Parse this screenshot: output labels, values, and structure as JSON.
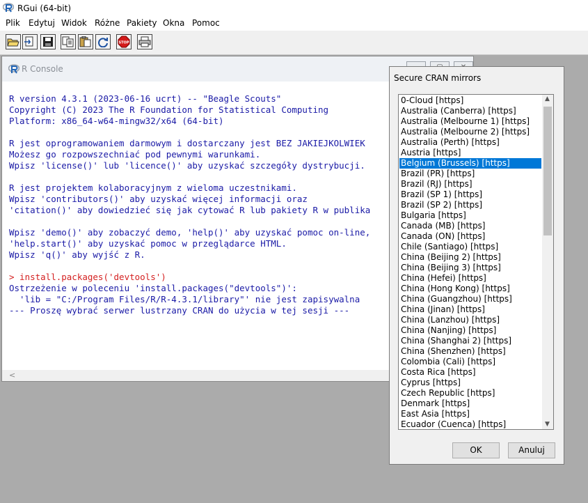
{
  "app": {
    "title": "RGui (64-bit)"
  },
  "menubar": [
    "Plik",
    "Edytuj",
    "Widok",
    "Różne",
    "Pakiety",
    "Okna",
    "Pomoc"
  ],
  "toolbar": {
    "buttons": [
      "open-script-icon",
      "load-workspace-icon",
      "save-icon",
      "copy-icon",
      "paste-icon",
      "refresh-icon",
      "stop-icon",
      "print-icon"
    ],
    "stop_label": "STOP"
  },
  "console": {
    "title": "R Console",
    "lines": [
      {
        "text": "R version 4.3.1 (2023-06-16 ucrt) -- \"Beagle Scouts\"",
        "kind": "out"
      },
      {
        "text": "Copyright (C) 2023 The R Foundation for Statistical Computing",
        "kind": "out"
      },
      {
        "text": "Platform: x86_64-w64-mingw32/x64 (64-bit)",
        "kind": "out"
      },
      {
        "text": "",
        "kind": "blank"
      },
      {
        "text": "R jest oprogramowaniem darmowym i dostarczany jest BEZ JAKIEJKOLWIEK",
        "kind": "out"
      },
      {
        "text": "Możesz go rozpowszechniać pod pewnymi warunkami.",
        "kind": "out"
      },
      {
        "text": "Wpisz 'license()' lub 'licence()' aby uzyskać szczegóły dystrybucji.",
        "kind": "out"
      },
      {
        "text": "",
        "kind": "blank"
      },
      {
        "text": "R jest projektem kolaboracyjnym z wieloma uczestnikami.",
        "kind": "out"
      },
      {
        "text": "Wpisz 'contributors()' aby uzyskać więcej informacji oraz",
        "kind": "out"
      },
      {
        "text": "'citation()' aby dowiedzieć się jak cytować R lub pakiety R w publika",
        "kind": "out"
      },
      {
        "text": "",
        "kind": "blank"
      },
      {
        "text": "Wpisz 'demo()' aby zobaczyć demo, 'help()' aby uzyskać pomoc on-line,",
        "kind": "out"
      },
      {
        "text": "'help.start()' aby uzyskać pomoc w przeglądarce HTML.",
        "kind": "out"
      },
      {
        "text": "Wpisz 'q()' aby wyjść z R.",
        "kind": "out"
      },
      {
        "text": "",
        "kind": "blank"
      },
      {
        "text": "> install.packages('devtools')",
        "kind": "prompt"
      },
      {
        "text": "Ostrzeżenie w poleceniu 'install.packages(\"devtools\")':",
        "kind": "out"
      },
      {
        "text": "  'lib = \"C:/Program Files/R/R-4.3.1/library\"' nie jest zapisywalna",
        "kind": "out"
      },
      {
        "text": "--- Proszę wybrać serwer lustrzany CRAN do użycia w tej sesji ---",
        "kind": "out"
      }
    ]
  },
  "dialog": {
    "title": "Secure CRAN mirrors",
    "selected": "Belgium (Brussels) [https]",
    "mirrors": [
      "0-Cloud [https]",
      "Australia (Canberra) [https]",
      "Australia (Melbourne 1) [https]",
      "Australia (Melbourne 2) [https]",
      "Australia (Perth) [https]",
      "Austria [https]",
      "Belgium (Brussels) [https]",
      "Brazil (PR) [https]",
      "Brazil (RJ) [https]",
      "Brazil (SP 1) [https]",
      "Brazil (SP 2) [https]",
      "Bulgaria [https]",
      "Canada (MB) [https]",
      "Canada (ON) [https]",
      "Chile (Santiago) [https]",
      "China (Beijing 2) [https]",
      "China (Beijing 3) [https]",
      "China (Hefei) [https]",
      "China (Hong Kong) [https]",
      "China (Guangzhou) [https]",
      "China (Jinan) [https]",
      "China (Lanzhou) [https]",
      "China (Nanjing) [https]",
      "China (Shanghai 2) [https]",
      "China (Shenzhen) [https]",
      "Colombia (Cali) [https]",
      "Costa Rica [https]",
      "Cyprus [https]",
      "Czech Republic [https]",
      "Denmark [https]",
      "East Asia [https]",
      "Ecuador (Cuenca) [https]"
    ],
    "ok_label": "OK",
    "cancel_label": "Anuluj"
  }
}
